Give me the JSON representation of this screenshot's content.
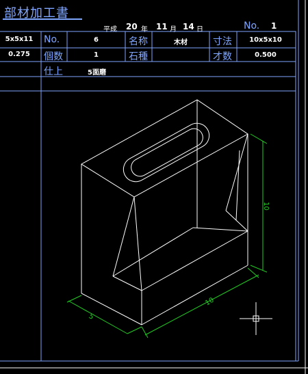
{
  "title": "部材加工書",
  "header": {
    "era": "平成",
    "year": "20",
    "year_unit": "年",
    "month": "11",
    "month_unit": "月",
    "day": "14",
    "day_unit": "日",
    "no_label": "No.",
    "no_value": "1"
  },
  "table": {
    "left_dim": "5x5x11",
    "left_val": "0.275",
    "row1": {
      "no_label": "No.",
      "no_value": "6",
      "name_label": "名称",
      "name_value": "木材",
      "size_label": "寸法",
      "size_value": "10x5x10"
    },
    "row2": {
      "qty_label": "個数",
      "qty_value": "1",
      "stone_label": "石種",
      "stone_value": "",
      "volume_label": "才数",
      "volume_value": "0.500"
    },
    "row3": {
      "finish_label": "仕上",
      "finish_value": "5面磨"
    }
  },
  "dimensions": {
    "height": "10",
    "length": "10",
    "width": "5"
  },
  "colors": {
    "frame": "#7fa6ff",
    "lines": "#ffffff",
    "dims": "#22cc22"
  },
  "icons": {
    "cursor": "crosshair-cursor-icon"
  }
}
